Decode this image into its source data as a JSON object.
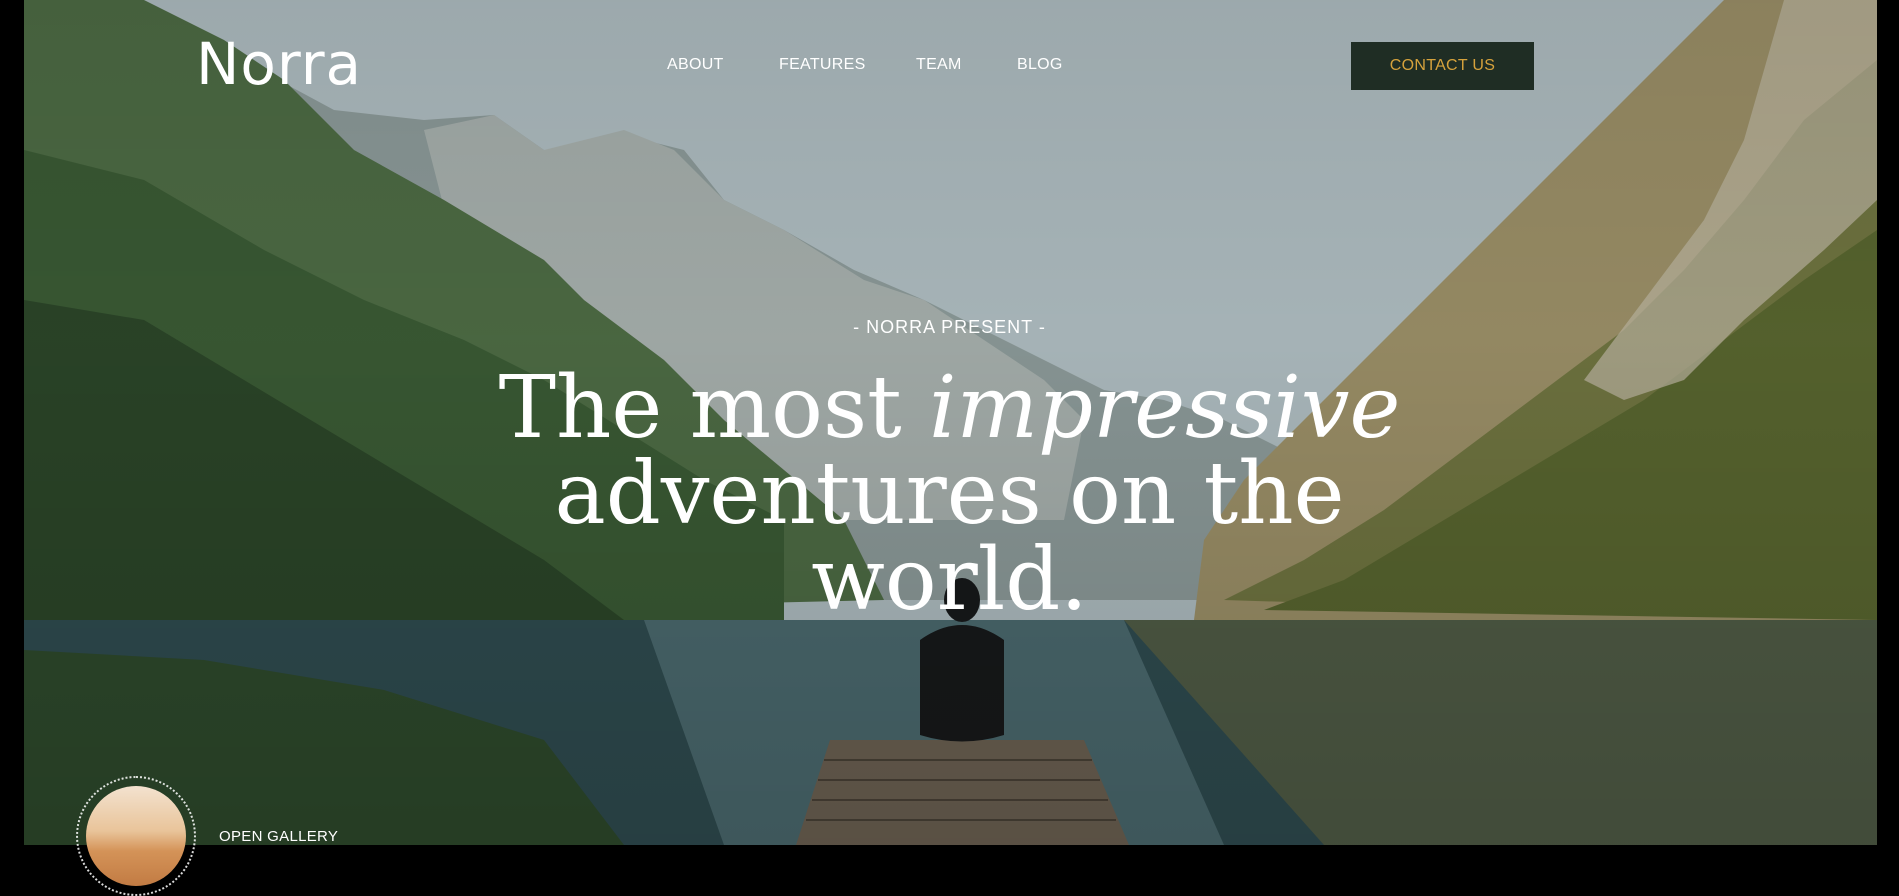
{
  "brand": {
    "logo_text": "Norra"
  },
  "nav": {
    "items": [
      {
        "label": "ABOUT"
      },
      {
        "label": "FEATURES"
      },
      {
        "label": "TEAM"
      },
      {
        "label": "BLOG"
      }
    ],
    "contact_label": "CONTACT US"
  },
  "hero": {
    "eyebrow": "- NORRA PRESENT -",
    "headline_line1_regular": "The most",
    "headline_line1_italic": "impressive",
    "headline_line2": "adventures on the",
    "headline_line3": "world."
  },
  "gallery": {
    "label": "OPEN GALLERY",
    "thumb_icon": "desert-dune-thumbnail"
  },
  "colors": {
    "contact_bg": "#1f2d24",
    "contact_text": "#d6a23c",
    "text": "#ffffff"
  }
}
